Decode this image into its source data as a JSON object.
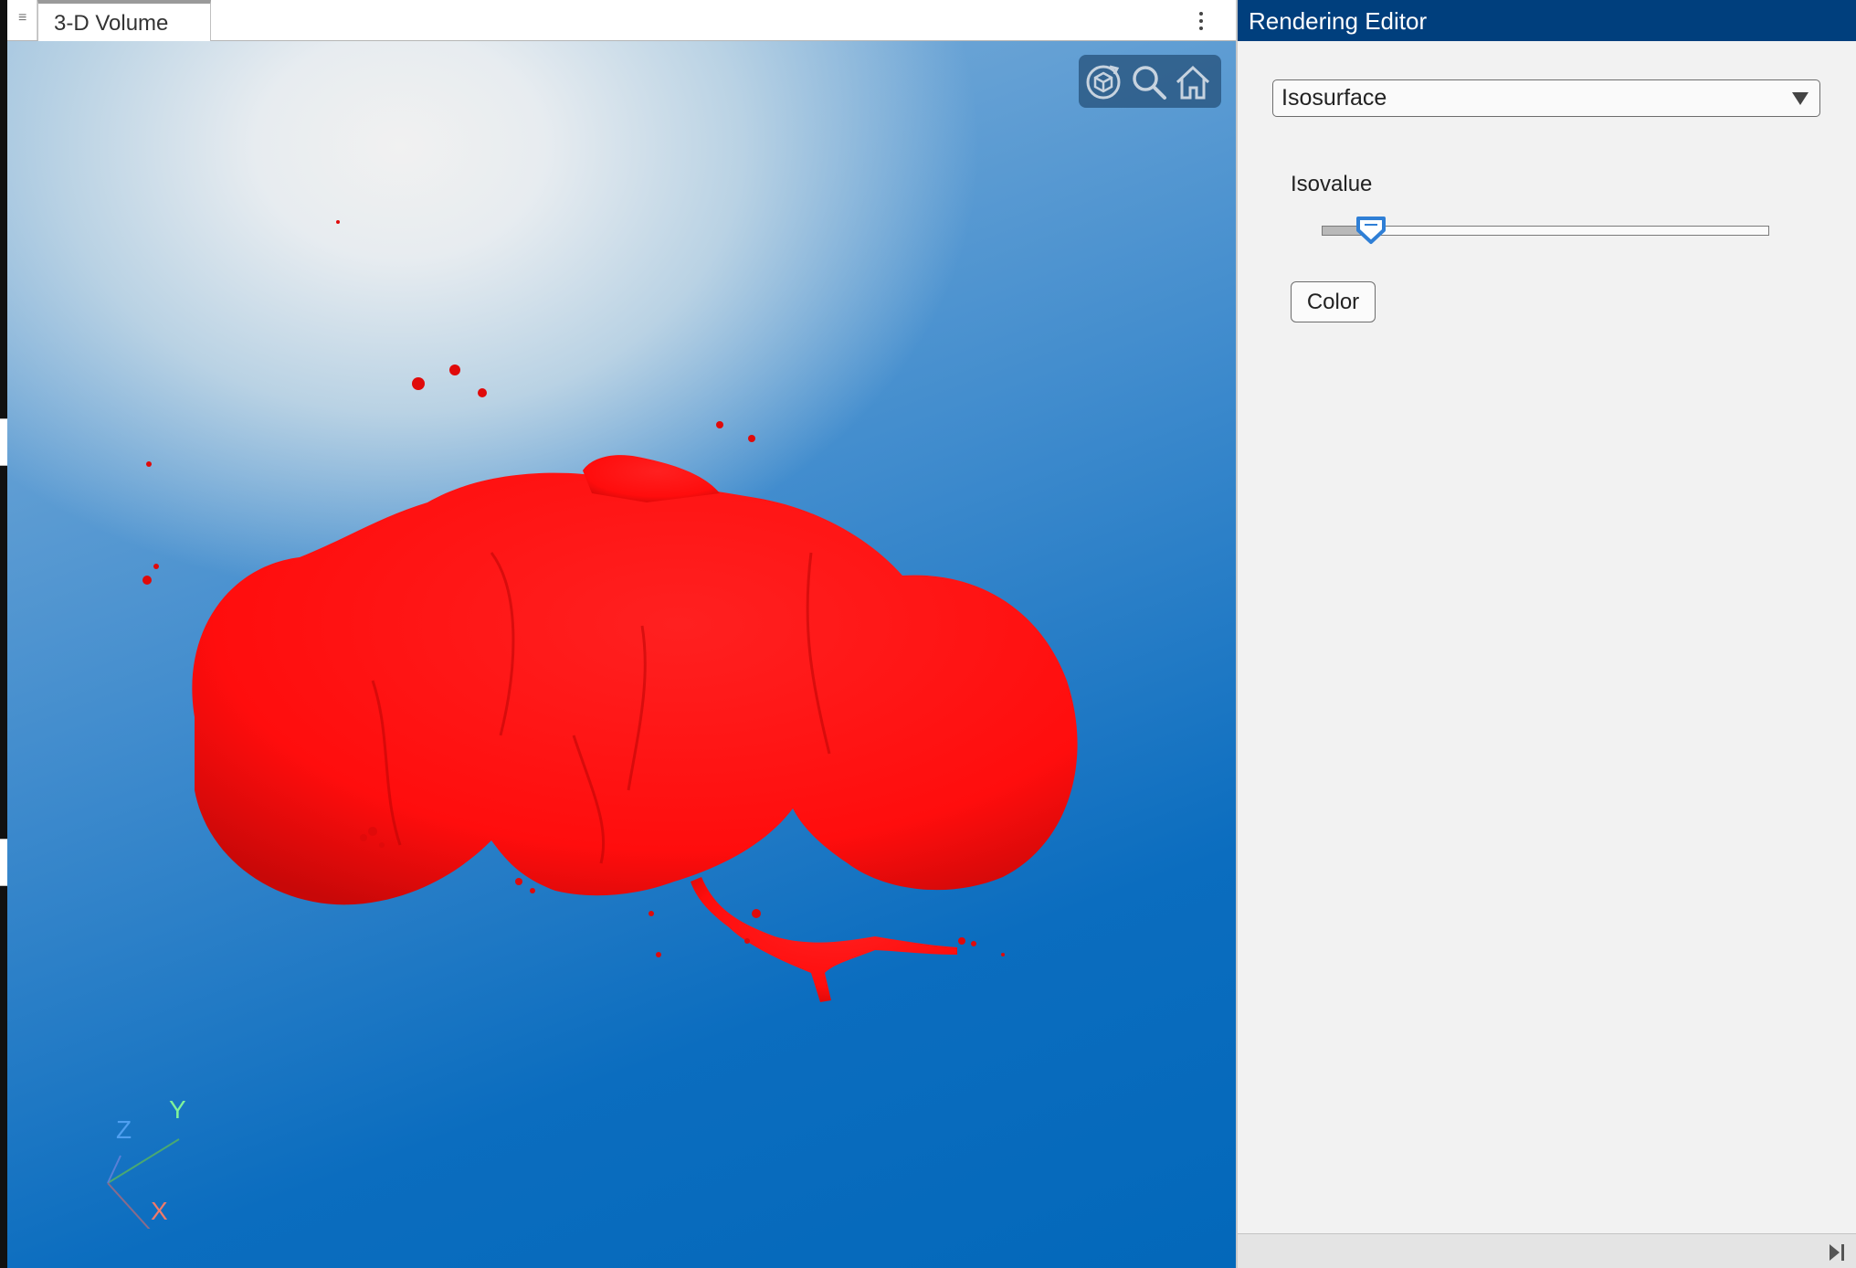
{
  "document_tab": {
    "label": "3-D Volume"
  },
  "toolbar": {
    "icons": [
      "rotate-cube-icon",
      "zoom-magnifier-icon",
      "home-icon"
    ]
  },
  "axes_indicator": {
    "x_label": "X",
    "y_label": "Y",
    "z_label": "Z"
  },
  "volume_color": "#ff0d0d",
  "rendering_editor": {
    "title": "Rendering Editor",
    "style_select": {
      "value": "Isosurface"
    },
    "isovalue": {
      "label": "Isovalue",
      "level": 0.11
    },
    "color_button_label": "Color"
  },
  "colors": {
    "header_bg": "#003f7d",
    "slider_thumb": "#2f7fd6",
    "background_top": "#f1f1f1",
    "background_bottom": "#0368ba"
  }
}
